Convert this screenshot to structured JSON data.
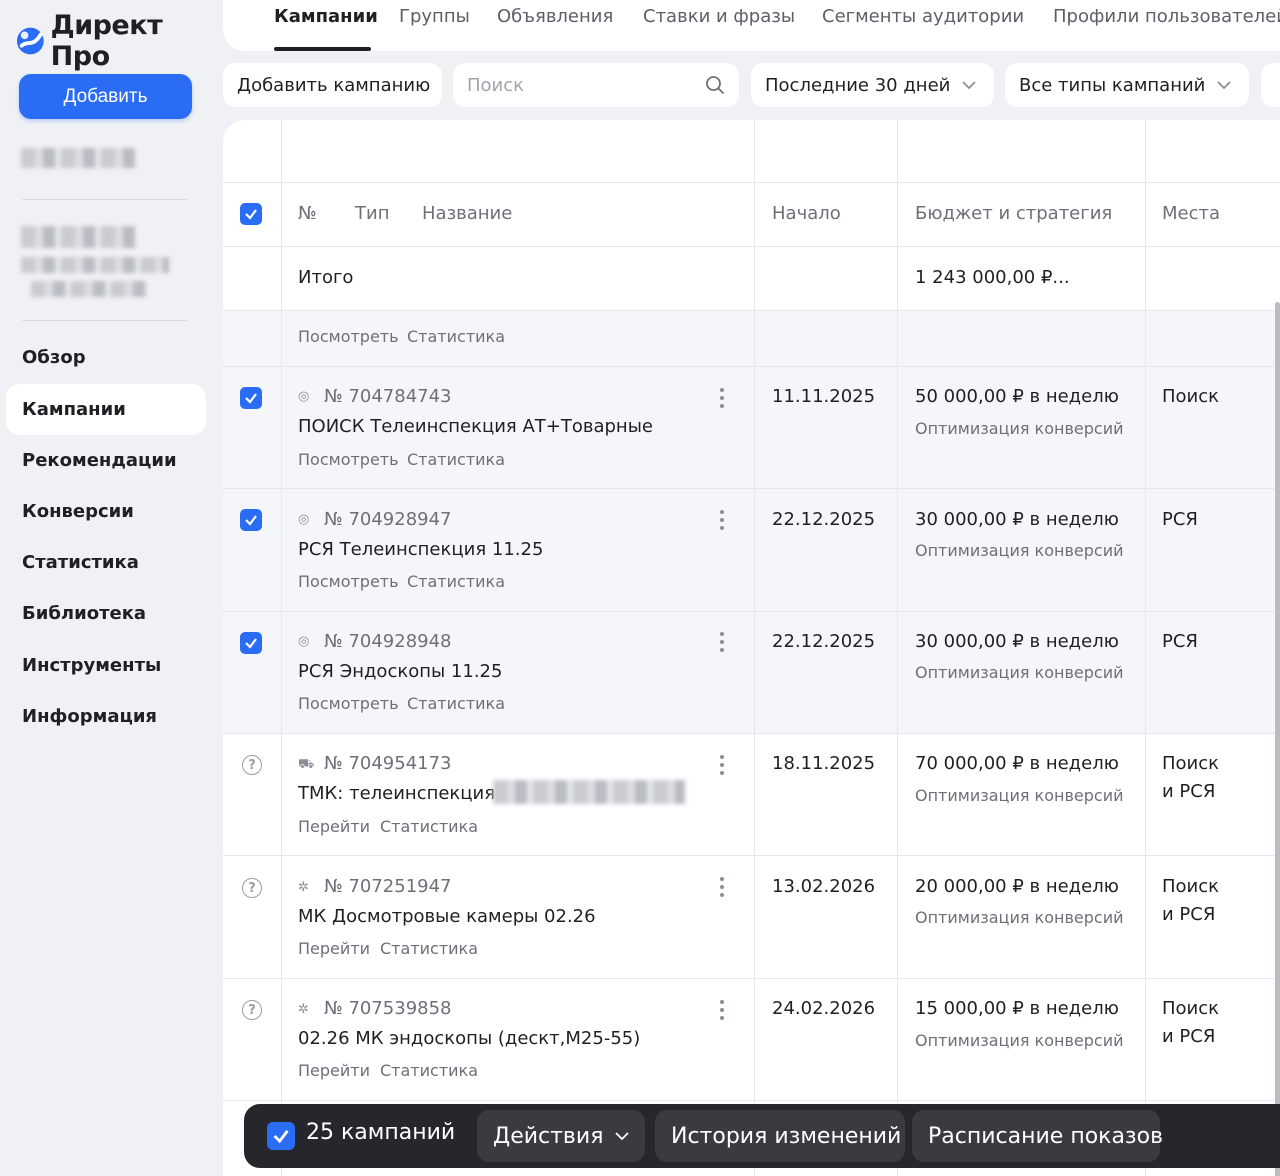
{
  "app": {
    "logo": "Директ Про"
  },
  "sidebar": {
    "add_button": "Добавить",
    "items": [
      {
        "label": "Обзор"
      },
      {
        "label": "Кампании"
      },
      {
        "label": "Рекомендации"
      },
      {
        "label": "Конверсии"
      },
      {
        "label": "Статистика"
      },
      {
        "label": "Библиотека"
      },
      {
        "label": "Инструменты"
      },
      {
        "label": "Информация"
      }
    ]
  },
  "tabs": [
    {
      "label": "Кампании"
    },
    {
      "label": "Группы"
    },
    {
      "label": "Объявления"
    },
    {
      "label": "Ставки и фразы"
    },
    {
      "label": "Сегменты аудитории"
    },
    {
      "label": "Профили пользователей"
    }
  ],
  "filters": {
    "add_campaign": "Добавить кампанию",
    "search_placeholder": "Поиск",
    "period": "Последние 30 дней",
    "campaign_types": "Все типы кампаний"
  },
  "table": {
    "headers": {
      "num": "№",
      "type": "Тип",
      "name": "Название",
      "start": "Начало",
      "budget": "Бюджет и стратегия",
      "places": "Места"
    },
    "total_label": "Итого",
    "total_budget": "1 243 000,00 ₽...",
    "partial_row": {
      "link1": "Посмотреть",
      "link2": "Статистика"
    },
    "rows": [
      {
        "num": "№ 704784743",
        "name": "ПОИСК Телеинспекция АТ+Товарные",
        "link1": "Посмотреть",
        "link2": "Статистика",
        "start": "11.11.2025",
        "budget": "50 000,00 ₽ в неделю",
        "strategy": "Оптимизация конверсий",
        "places1": "Поиск",
        "places2": ""
      },
      {
        "num": "№ 704928947",
        "name": "РСЯ Телеинспекция 11.25",
        "link1": "Посмотреть",
        "link2": "Статистика",
        "start": "22.12.2025",
        "budget": "30 000,00 ₽ в неделю",
        "strategy": "Оптимизация конверсий",
        "places1": "РСЯ",
        "places2": ""
      },
      {
        "num": "№ 704928948",
        "name": "РСЯ Эндоскопы 11.25",
        "link1": "Посмотреть",
        "link2": "Статистика",
        "start": "22.12.2025",
        "budget": "30 000,00 ₽ в неделю",
        "strategy": "Оптимизация конверсий",
        "places1": "РСЯ",
        "places2": ""
      },
      {
        "num": "№ 704954173",
        "name": "ТМК: телеинспекция",
        "link1": "Перейти",
        "link2": "Статистика",
        "start": "18.11.2025",
        "budget": "70 000,00 ₽ в неделю",
        "strategy": "Оптимизация конверсий",
        "places1": "Поиск",
        "places2": "и РСЯ"
      },
      {
        "num": "№ 707251947",
        "name": "МК Досмотровые камеры 02.26",
        "link1": "Перейти",
        "link2": "Статистика",
        "start": "13.02.2026",
        "budget": "20 000,00 ₽ в неделю",
        "strategy": "Оптимизация конверсий",
        "places1": "Поиск",
        "places2": "и РСЯ"
      },
      {
        "num": "№ 707539858",
        "name": "02.26 МК эндоскопы (дескт,М25-55)",
        "link1": "Перейти",
        "link2": "Статистика",
        "start": "24.02.2026",
        "budget": "15 000,00 ₽ в неделю",
        "strategy": "Оптимизация конверсий",
        "places1": "Поиск",
        "places2": "и РСЯ"
      }
    ]
  },
  "action_bar": {
    "count": "25 кампаний",
    "actions": "Действия",
    "history": "История изменений",
    "schedule": "Расписание показов"
  },
  "colors": {
    "accent": "#2a6df4",
    "background": "#f0f1f5",
    "action_bar": "#26272c"
  }
}
